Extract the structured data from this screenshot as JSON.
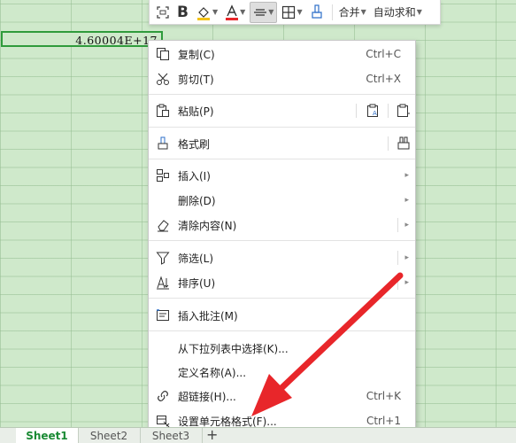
{
  "cell": {
    "value": "4.60004E+17"
  },
  "toolbar": {
    "merge_label": "合并",
    "autosum_label": "自动求和"
  },
  "menu": {
    "copy": {
      "label": "复制(C)",
      "shortcut": "Ctrl+C"
    },
    "cut": {
      "label": "剪切(T)",
      "shortcut": "Ctrl+X"
    },
    "paste": {
      "label": "粘贴(P)"
    },
    "format_painter": {
      "label": "格式刷"
    },
    "insert": {
      "label": "插入(I)"
    },
    "delete": {
      "label": "删除(D)"
    },
    "clear": {
      "label": "清除内容(N)"
    },
    "filter": {
      "label": "筛选(L)"
    },
    "sort": {
      "label": "排序(U)"
    },
    "insert_comment": {
      "label": "插入批注(M)"
    },
    "pick_from_list": {
      "label": "从下拉列表中选择(K)..."
    },
    "define_name": {
      "label": "定义名称(A)..."
    },
    "hyperlink": {
      "label": "超链接(H)...",
      "shortcut": "Ctrl+K"
    },
    "format_cells": {
      "label": "设置单元格格式(F)...",
      "shortcut": "Ctrl+1"
    }
  },
  "sheets": [
    {
      "label": "Sheet1",
      "active": true
    },
    {
      "label": "Sheet2",
      "active": false
    },
    {
      "label": "Sheet3",
      "active": false
    }
  ],
  "colors": {
    "accent_green": "#2f9b3c",
    "arrow_red": "#e8262a",
    "grid_bg": "#cfe9cb"
  }
}
